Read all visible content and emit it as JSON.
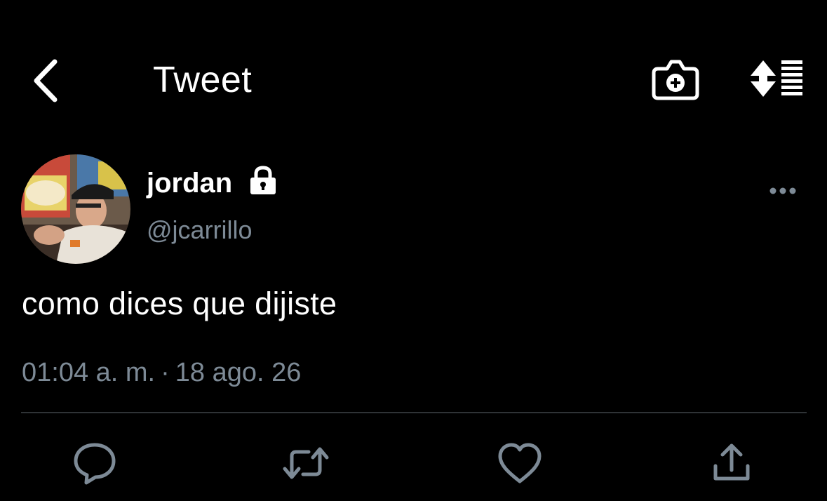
{
  "header": {
    "title": "Tweet",
    "back_icon": "chevron-left-icon",
    "camera_icon": "camera-plus-icon",
    "sort_icon": "sort-updown-icon"
  },
  "tweet": {
    "author": {
      "display_name": "jordan",
      "handle": "@jcarrillo",
      "protected": true,
      "lock_icon": "lock-icon"
    },
    "text": "como dices que dijiste",
    "time": "01:04 a. m.",
    "separator": "·",
    "date": "18 ago. 26",
    "more_icon": "ellipsis-icon"
  },
  "actions": [
    {
      "name": "reply",
      "icon": "comment-icon"
    },
    {
      "name": "retweet",
      "icon": "retweet-icon"
    },
    {
      "name": "like",
      "icon": "heart-icon"
    },
    {
      "name": "share",
      "icon": "share-icon"
    }
  ],
  "colors": {
    "background": "#000000",
    "text": "#ffffff",
    "secondary": "#7d8a96",
    "divider": "#2f3336"
  }
}
